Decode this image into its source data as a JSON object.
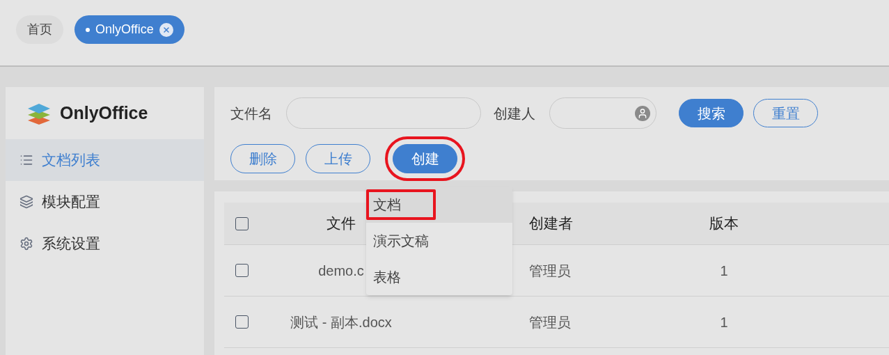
{
  "tabs": [
    {
      "label": "首页",
      "selected": false,
      "closable": false
    },
    {
      "label": "OnlyOffice",
      "selected": true,
      "closable": true
    }
  ],
  "sidebar": {
    "title": "OnlyOffice",
    "items": [
      {
        "label": "文档列表",
        "kind": "list",
        "selected": true
      },
      {
        "label": "模块配置",
        "kind": "layers",
        "selected": false
      },
      {
        "label": "系统设置",
        "kind": "gear",
        "selected": false
      }
    ]
  },
  "filters": [
    {
      "label": "文件名",
      "kind": "text"
    },
    {
      "label": "创建人",
      "kind": "user"
    }
  ],
  "filter_buttons": [
    {
      "label": "搜索",
      "primary": true
    },
    {
      "label": "重置",
      "primary": false
    }
  ],
  "actions": [
    {
      "label": "删除",
      "primary": false,
      "highlighted": false
    },
    {
      "label": "上传",
      "primary": false,
      "highlighted": false
    },
    {
      "label": "创建",
      "primary": true,
      "highlighted": true
    }
  ],
  "create_menu": [
    {
      "label": "文档",
      "selected": true,
      "highlighted": true
    },
    {
      "label": "演示文稿",
      "selected": false,
      "highlighted": false
    },
    {
      "label": "表格",
      "selected": false,
      "highlighted": false
    }
  ],
  "table": {
    "all_checked": false,
    "columns": [
      "文件",
      "创建者",
      "版本"
    ],
    "rows": [
      {
        "checked": false,
        "cells": [
          "demo.c",
          "管理员",
          "1"
        ]
      },
      {
        "checked": false,
        "cells": [
          "测试 - 副本.docx",
          "管理员",
          "1"
        ]
      }
    ]
  }
}
